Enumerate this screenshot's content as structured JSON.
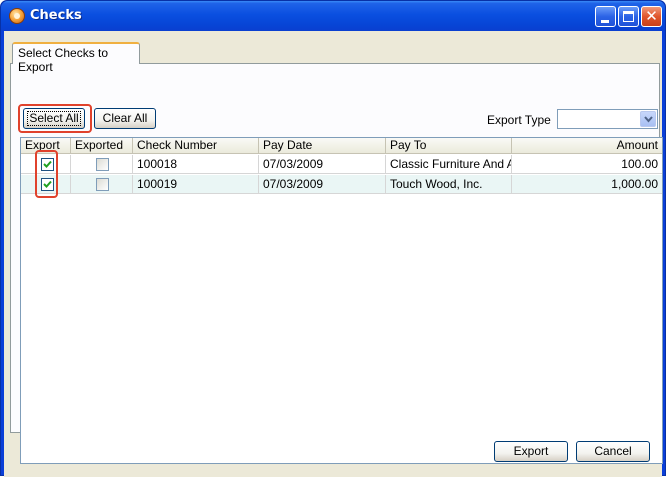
{
  "window": {
    "title": "Checks"
  },
  "tab": {
    "label": "Select Checks to Export"
  },
  "toolbar": {
    "select_all_label": "Select All",
    "clear_all_label": "Clear All",
    "export_type_label": "Export Type",
    "export_type_value": ""
  },
  "table": {
    "columns": [
      "Export",
      "Exported",
      "Check Number",
      "Pay Date",
      "Pay To",
      "Amount"
    ],
    "rows": [
      {
        "export": true,
        "exported": false,
        "check_number": "100018",
        "pay_date": "07/03/2009",
        "pay_to": "Classic Furniture And App",
        "amount": "100.00"
      },
      {
        "export": true,
        "exported": false,
        "check_number": "100019",
        "pay_date": "07/03/2009",
        "pay_to": "Touch Wood, Inc.",
        "amount": "1,000.00"
      }
    ]
  },
  "footer": {
    "export_label": "Export",
    "cancel_label": "Cancel"
  },
  "colors": {
    "titlebar": "#0a4fe0",
    "highlight": "#e0422c",
    "alt_row": "#eaf6f5"
  }
}
